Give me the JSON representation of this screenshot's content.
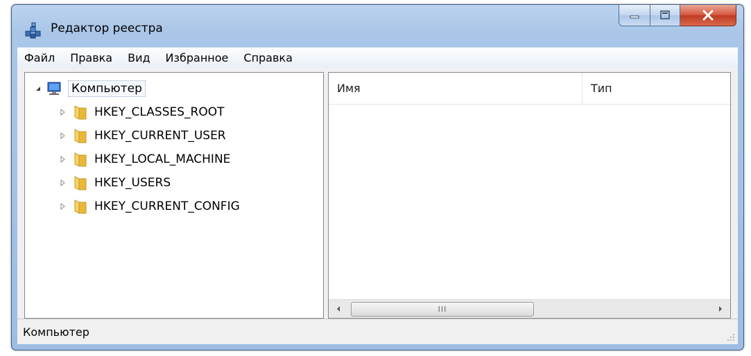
{
  "window": {
    "title": "Редактор реестра"
  },
  "menubar": {
    "items": [
      "Файл",
      "Правка",
      "Вид",
      "Избранное",
      "Справка"
    ]
  },
  "tree": {
    "root": {
      "label": "Компьютер",
      "icon": "computer-icon",
      "expanded": true
    },
    "children": [
      {
        "label": "HKEY_CLASSES_ROOT",
        "icon": "folder-icon"
      },
      {
        "label": "HKEY_CURRENT_USER",
        "icon": "folder-icon"
      },
      {
        "label": "HKEY_LOCAL_MACHINE",
        "icon": "folder-icon"
      },
      {
        "label": "HKEY_USERS",
        "icon": "folder-icon"
      },
      {
        "label": "HKEY_CURRENT_CONFIG",
        "icon": "folder-icon"
      }
    ]
  },
  "list": {
    "columns": [
      "Имя",
      "Тип"
    ]
  },
  "scrollbar": {
    "thumb_grip": "III"
  },
  "status": {
    "text": "Компьютер"
  },
  "colors": {
    "accent": "#9dbde3",
    "close": "#c03a22",
    "folder": "#e8b83a"
  }
}
